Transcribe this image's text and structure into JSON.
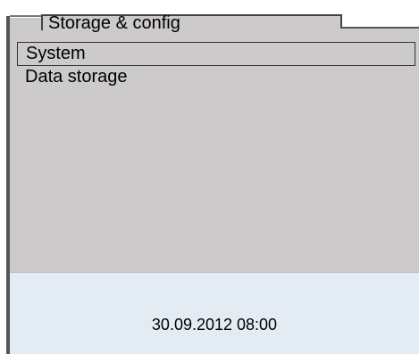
{
  "header": {
    "title": "Storage & config"
  },
  "menu": {
    "items": [
      {
        "label": "System",
        "selected": true
      },
      {
        "label": "Data storage",
        "selected": false
      }
    ]
  },
  "status_bar": {
    "datetime": "30.09.2012 08:00"
  },
  "colors": {
    "panel": "#cccacb",
    "footer": "#e3ecf3",
    "border": "#444444"
  }
}
